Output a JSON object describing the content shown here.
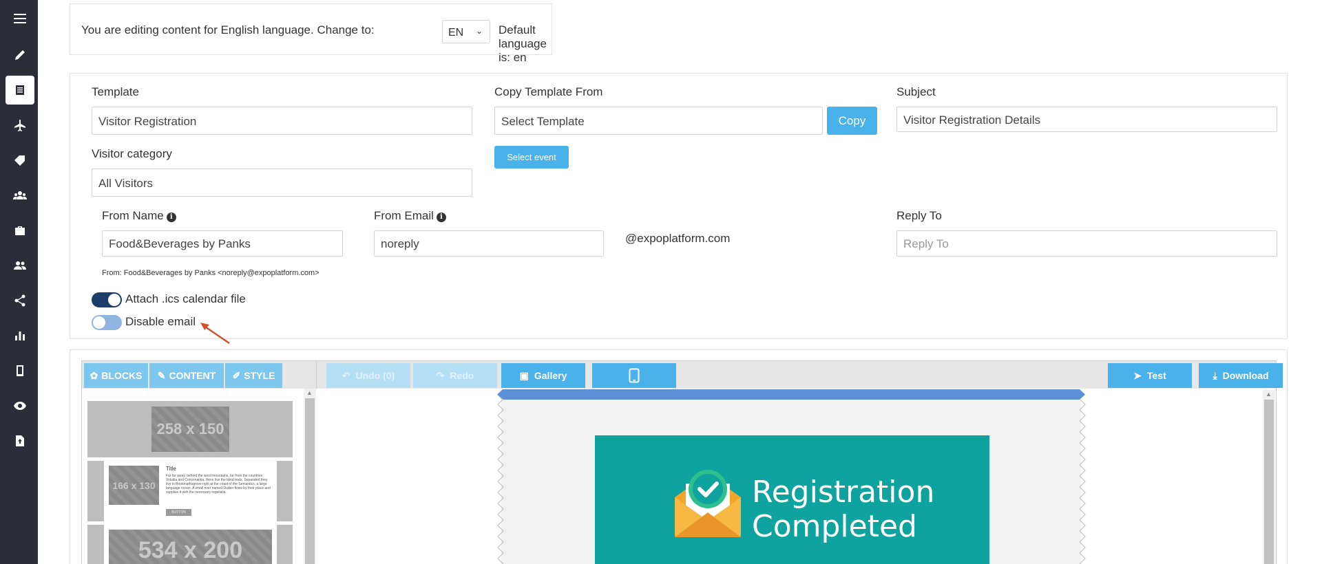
{
  "sidebar": {
    "items": [
      {
        "icon": "menu-icon"
      },
      {
        "icon": "pencil-icon"
      },
      {
        "icon": "list-document-icon",
        "active": true
      },
      {
        "icon": "plane-icon"
      },
      {
        "icon": "tag-icon"
      },
      {
        "icon": "users-group-icon"
      },
      {
        "icon": "briefcase-icon"
      },
      {
        "icon": "users-icon"
      },
      {
        "icon": "share-icon"
      },
      {
        "icon": "bar-chart-icon"
      },
      {
        "icon": "mobile-icon"
      },
      {
        "icon": "eye-icon"
      },
      {
        "icon": "file-upload-icon"
      }
    ]
  },
  "language_bar": {
    "text_before": "You are editing content for English language. Change to:",
    "selected_language": "EN",
    "text_after": "Default language is: en"
  },
  "form": {
    "template_label": "Template",
    "template_value": "Visitor Registration",
    "copy_template_label": "Copy Template From",
    "copy_template_placeholder": "Select Template",
    "copy_button": "Copy",
    "select_event_button": "Select event",
    "subject_label": "Subject",
    "subject_value": "Visitor Registration Details",
    "visitor_category_label": "Visitor category",
    "visitor_category_value": "All Visitors",
    "from_name_label": "From Name",
    "from_name_value": "Food&Beverages by Panks",
    "from_email_label": "From Email",
    "from_email_value": "noreply",
    "email_domain": "@expoplatform.com",
    "reply_to_label": "Reply To",
    "reply_to_placeholder": "Reply To",
    "from_preview": "From: Food&Beverages by Panks <noreply@expoplatform.com>",
    "attach_ics_label": "Attach .ics calendar file",
    "attach_ics_enabled": true,
    "disable_email_label": "Disable email",
    "disable_email_enabled": false,
    "arrow_color": "#d0502b"
  },
  "editor": {
    "tabs": [
      {
        "label": "BLOCKS",
        "icon": "blocks-icon"
      },
      {
        "label": "CONTENT",
        "icon": "pencil-icon"
      },
      {
        "label": "STYLE",
        "icon": "brush-icon"
      }
    ],
    "toolbar": {
      "undo_label": "Undo (0)",
      "redo_label": "Redo",
      "gallery_label": "Gallery",
      "test_label": "Test",
      "download_label": "Download"
    },
    "blocks": {
      "block1_placeholder": "258 x 150",
      "block2_placeholder": "166 x 130",
      "block2_title": "Title",
      "block2_text": "Far far away, behind the word mountains, far from the countries Vokalia and Consonantia, there live the blind texts. Separated they live in Bookmarksgrove right at the coast of the Semantics, a large language ocean. A small river named Duden flows by their place and supplies it with the necessary regelialia.",
      "block2_button": "BUTTON",
      "block3_placeholder": "534 x 200"
    },
    "email_preview": {
      "hero_line1": "Registration",
      "hero_line2": "Completed",
      "hero_color": "#0fa3a0",
      "topbar_color": "#5b8fd6"
    }
  }
}
